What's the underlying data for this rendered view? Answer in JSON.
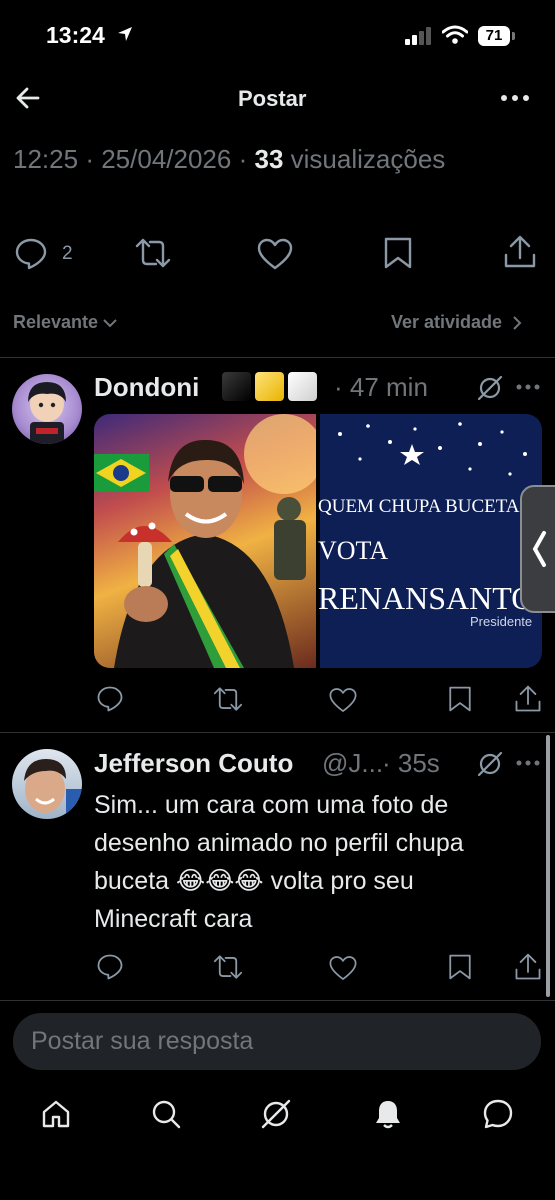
{
  "status_bar": {
    "time": "13:24",
    "battery": "71"
  },
  "header": {
    "title": "Postar",
    "back_icon": "arrow-left-icon",
    "more_icon": "more-horizontal-icon"
  },
  "post_meta": {
    "time": "12:25",
    "sep1": "·",
    "date": "25/04/2026",
    "sep2": "·",
    "views_count": "33",
    "views_label": "visualizações"
  },
  "actions": {
    "replies": "2"
  },
  "filter": {
    "sort_label": "Relevante",
    "activity_label": "Ver atividade"
  },
  "reply1": {
    "name": "Dondoni",
    "time": "· 47 min",
    "image_right_lines": [
      "QUEM CHUPA BUCETA",
      "VOTA",
      "RENANSANTOS",
      "Presidente"
    ]
  },
  "reply2": {
    "name": "Jefferson Couto",
    "handle": "@J...",
    "time": "· 35s",
    "text_lines": [
      "Sim... um cara com uma foto de",
      "desenho animado no perfil chupa",
      "buceta 😂😂😂 volta pro seu",
      "Minecraft cara"
    ]
  },
  "composer": {
    "placeholder": "Postar sua resposta"
  },
  "colors": {
    "background": "#000000",
    "text": "#e7e9ea",
    "muted": "#71767b",
    "divider": "#2f3336",
    "composer_bg": "#202327",
    "image_blue": "#0d1f55"
  }
}
